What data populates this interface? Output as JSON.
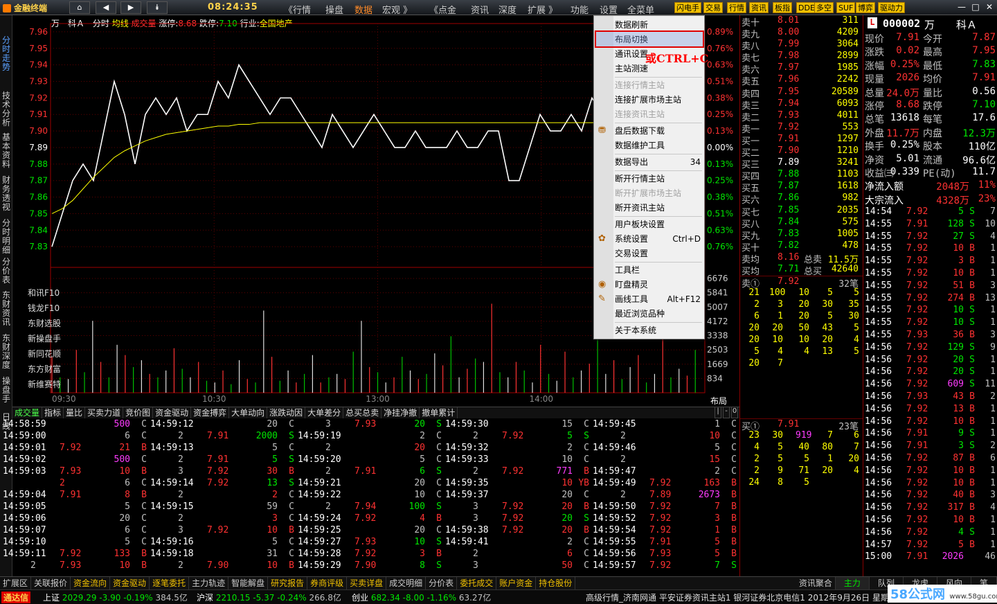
{
  "titlebar": {
    "app_name": "金融终端",
    "clock": "08:24:35",
    "menus": [
      "《行情",
      "操盘",
      "数据",
      "宏观 》",
      "《点金",
      "资讯",
      "深度",
      "扩展 》",
      "功能",
      "设置",
      "全菜单"
    ],
    "active_menu": "数据",
    "buttons": [
      "闪电手",
      "交易",
      "行情",
      "资讯",
      "板指",
      "DDE",
      "多空",
      "SUF",
      "博弈",
      "驱动力"
    ]
  },
  "sidebar": {
    "tabs": [
      "分时走势",
      "技术分析",
      "基本资料",
      "财务透视",
      "分时明细",
      "分价表",
      "东财资讯",
      "东财深度",
      "操盘手",
      "日线"
    ]
  },
  "chart_header": {
    "code": "万　科Ａ",
    "items": [
      "分时",
      "均线",
      "成交量"
    ],
    "limit_up_label": "涨停:",
    "limit_up": "8.68",
    "limit_down_label": "跌停:",
    "limit_down": "7.10",
    "industry_label": "行业:",
    "industry": "全国地产"
  },
  "chart_data": {
    "type": "line",
    "price_ticks": [
      "7.96",
      "7.95",
      "7.94",
      "7.93",
      "7.92",
      "7.91",
      "7.90",
      "7.89",
      "7.88",
      "7.87",
      "7.86",
      "7.85",
      "7.84",
      "7.83"
    ],
    "pct_ticks": [
      "0.89%",
      "0.76%",
      "0.63%",
      "0.51%",
      "0.38%",
      "0.25%",
      "0.13%",
      "0.00%",
      "0.13%",
      "0.25%",
      "0.38%",
      "0.51%",
      "0.63%",
      "0.76%"
    ],
    "vol_ticks": [
      "6676",
      "5841",
      "5007",
      "4172",
      "3338",
      "2503",
      "1669",
      "834"
    ],
    "time_ticks": [
      "09:30",
      "10:30",
      "13:00",
      "14:00"
    ],
    "ylim": [
      7.82,
      7.965
    ],
    "prev_close": 7.89,
    "price_series": [
      7.83,
      7.85,
      7.87,
      7.88,
      7.87,
      7.9,
      7.93,
      7.91,
      7.88,
      7.91,
      7.92,
      7.91,
      7.92,
      7.9,
      7.91,
      7.91,
      7.93,
      7.92,
      7.94,
      7.93,
      7.92,
      7.91,
      7.92,
      7.92,
      7.91,
      7.9,
      7.89,
      7.91,
      7.9,
      7.89,
      7.9,
      7.91,
      7.9,
      7.89,
      7.89,
      7.9,
      7.89,
      7.89,
      7.89,
      7.9,
      7.89,
      7.89,
      7.9,
      7.9,
      7.87,
      7.87,
      7.89,
      7.91,
      7.9,
      7.9,
      7.91,
      7.9,
      7.92,
      7.91
    ],
    "avg_series": [
      7.85,
      7.853,
      7.858,
      7.865,
      7.872,
      7.878,
      7.884,
      7.888,
      7.891,
      7.894,
      7.896,
      7.898,
      7.899,
      7.9,
      7.901,
      7.902,
      7.903,
      7.903,
      7.904,
      7.904,
      7.905,
      7.905,
      7.905,
      7.905,
      7.905,
      7.905,
      7.905,
      7.905,
      7.905,
      7.905,
      7.905,
      7.905,
      7.905,
      7.905,
      7.905,
      7.905,
      7.905,
      7.905,
      7.905,
      7.905,
      7.905,
      7.905,
      7.905,
      7.905,
      7.905,
      7.905,
      7.905,
      7.905,
      7.905,
      7.905,
      7.905,
      7.905,
      7.905,
      7.905
    ],
    "vol_ylim": [
      0,
      7000
    ],
    "volume_series": [
      2100,
      900,
      800,
      2500,
      1200,
      4200,
      1800,
      900,
      2800,
      2200,
      1500,
      1900,
      1100,
      900,
      1300,
      2600,
      1400,
      900,
      1800,
      700,
      600,
      1300,
      500,
      1900,
      800,
      600,
      4800,
      2100,
      700,
      1300,
      600,
      1100,
      2200,
      600,
      900,
      1100,
      800,
      2400,
      4200,
      1500,
      1200,
      600,
      900,
      2100,
      1300,
      800,
      1100,
      2300,
      1600,
      3300,
      900,
      1400,
      2000,
      1800,
      5200,
      1200,
      900,
      1800,
      1300,
      600,
      2800,
      1100,
      700,
      2400,
      900,
      1300,
      1700,
      3100,
      1100,
      1900,
      800,
      1500,
      2200,
      600,
      1100,
      3600,
      900,
      1400,
      1000,
      2500
    ]
  },
  "chart_links": [
    "和讯F10",
    "钱龙F10",
    "东财选股",
    "新操盘手",
    "新同花顺",
    "东方财富",
    "新维赛特"
  ],
  "layout_label": "布局",
  "mid_tabs": [
    "成交量",
    "指标",
    "量比",
    "买卖力道",
    "竞价图",
    "资金驱动",
    "资金搏弈",
    "大单动向",
    "涨跌动因",
    "大单差分",
    "总买总卖",
    "净挂净撤",
    "撤单累计"
  ],
  "mid_tab_right": [
    "|",
    "-",
    "0"
  ],
  "context_menu": {
    "items": [
      {
        "label": "数据刷新",
        "enabled": true
      },
      {
        "label": "布局切换",
        "enabled": true,
        "highlight": true
      },
      {
        "label": "通讯设置",
        "enabled": true
      },
      {
        "label": "主站测速",
        "enabled": true
      },
      {
        "sep": true
      },
      {
        "label": "连接行情主站",
        "enabled": false
      },
      {
        "label": "连接扩展市场主站",
        "enabled": true
      },
      {
        "label": "连接资讯主站",
        "enabled": false
      },
      {
        "sep": true
      },
      {
        "label": "盘后数据下载",
        "enabled": true,
        "icon": "download-icon"
      },
      {
        "label": "数据维护工具",
        "enabled": true
      },
      {
        "sep": true
      },
      {
        "label": "数据导出",
        "enabled": true,
        "shortcut": "34"
      },
      {
        "sep": true
      },
      {
        "label": "断开行情主站",
        "enabled": true
      },
      {
        "label": "断开扩展市场主站",
        "enabled": false
      },
      {
        "label": "断开资讯主站",
        "enabled": true
      },
      {
        "sep": true
      },
      {
        "label": "用户板块设置",
        "enabled": true
      },
      {
        "label": "系统设置",
        "enabled": true,
        "shortcut": "Ctrl+D",
        "icon": "gear-icon"
      },
      {
        "label": "交易设置",
        "enabled": true
      },
      {
        "sep": true
      },
      {
        "label": "工具栏",
        "enabled": true
      },
      {
        "label": "盯盘精灵",
        "enabled": true,
        "icon": "eye-icon"
      },
      {
        "label": "画线工具",
        "enabled": true,
        "shortcut": "Alt+F12",
        "icon": "pencil-icon"
      },
      {
        "label": "最近浏览品种",
        "enabled": true
      },
      {
        "sep": true
      },
      {
        "label": "关于本系统",
        "enabled": true
      }
    ],
    "annotation": "或CTRL+C"
  },
  "order_book": {
    "asks": [
      [
        "卖十",
        "8.01",
        "311"
      ],
      [
        "卖九",
        "8.00",
        "4209"
      ],
      [
        "卖八",
        "7.99",
        "3064"
      ],
      [
        "卖七",
        "7.98",
        "2899"
      ],
      [
        "卖六",
        "7.97",
        "1985"
      ],
      [
        "卖五",
        "7.96",
        "2242"
      ],
      [
        "卖四",
        "7.95",
        "20589"
      ],
      [
        "卖三",
        "7.94",
        "6093"
      ],
      [
        "卖二",
        "7.93",
        "4011"
      ],
      [
        "卖一",
        "7.92",
        "553"
      ]
    ],
    "bids": [
      [
        "买一",
        "7.91",
        "1297"
      ],
      [
        "买二",
        "7.90",
        "1210"
      ],
      [
        "买三",
        "7.89",
        "3241"
      ],
      [
        "买四",
        "7.88",
        "1103"
      ],
      [
        "买五",
        "7.87",
        "1618"
      ],
      [
        "买六",
        "7.86",
        "982"
      ],
      [
        "买七",
        "7.85",
        "2035"
      ],
      [
        "买八",
        "7.84",
        "575"
      ],
      [
        "买九",
        "7.83",
        "1005"
      ],
      [
        "买十",
        "7.82",
        "478"
      ]
    ],
    "avg_sell_label": "卖均",
    "avg_sell": "8.16",
    "total_sell_label": "总卖",
    "total_sell": "11.5万",
    "avg_buy_label": "买均",
    "avg_buy": "7.71",
    "total_buy_label": "总买",
    "total_buy": "42640",
    "sell1_queue_label": "卖①",
    "sell1_price": "7.92",
    "sell1_count": "32笔",
    "sell1_queue": [
      [
        "21",
        "100",
        "10",
        "5",
        "5"
      ],
      [
        "2",
        "3",
        "20",
        "30",
        "35"
      ],
      [
        "6",
        "1",
        "20",
        "5",
        "30"
      ],
      [
        "20",
        "20",
        "50",
        "43",
        "5"
      ],
      [
        "20",
        "10",
        "10",
        "20",
        "4"
      ],
      [
        "5",
        "4",
        "4",
        "13",
        "5"
      ],
      [
        "20",
        "7",
        "",
        "",
        ""
      ]
    ],
    "buy1_queue_label": "买①",
    "buy1_price": "7.91",
    "buy1_count": "23笔",
    "buy1_queue": [
      [
        "23",
        "30",
        "919",
        "7",
        "6"
      ],
      [
        "4",
        "5",
        "40",
        "80",
        "7"
      ],
      [
        "2",
        "5",
        "5",
        "1",
        "20"
      ],
      [
        "2",
        "9",
        "71",
        "20",
        "4"
      ],
      [
        "24",
        "8",
        "5",
        "",
        ""
      ]
    ]
  },
  "quote": {
    "code": "000002",
    "unit": "万",
    "name": "科Ａ",
    "rows": [
      [
        "现价",
        "7.91",
        "今开",
        "7.87"
      ],
      [
        "涨跌",
        "0.02",
        "最高",
        "7.95"
      ],
      [
        "涨幅",
        "0.25%",
        "最低",
        "7.83"
      ],
      [
        "现量",
        "2026",
        "均价",
        "7.91"
      ],
      [
        "总量",
        "24.0万",
        "量比",
        "0.56"
      ],
      [
        "涨停",
        "8.68",
        "跌停",
        "7.10"
      ],
      [
        "总笔",
        "13618",
        "每笔",
        "17.6"
      ],
      [
        "外盘",
        "11.7万",
        "内盘",
        "12.3万"
      ],
      [
        "换手",
        "0.25%",
        "股本",
        "110亿"
      ],
      [
        "净资",
        "5.01",
        "流通",
        "96.6亿"
      ],
      [
        "收益㈢",
        "0.339",
        "PE(动)",
        "11.7"
      ]
    ],
    "flow": [
      [
        "净流入额",
        "2048万",
        "11%"
      ],
      [
        "大宗流入",
        "4328万",
        "23%"
      ]
    ],
    "ticks": [
      [
        "14:54",
        "7.92",
        "5",
        "S",
        "7"
      ],
      [
        "14:55",
        "7.91",
        "128",
        "S",
        "10"
      ],
      [
        "14:55",
        "7.92",
        "27",
        "S",
        "4"
      ],
      [
        "14:55",
        "7.92",
        "10",
        "B",
        "1"
      ],
      [
        "14:55",
        "7.92",
        "3",
        "B",
        "1"
      ],
      [
        "14:55",
        "7.92",
        "10",
        "B",
        "1"
      ],
      [
        "14:55",
        "7.92",
        "51",
        "B",
        "3"
      ],
      [
        "14:55",
        "7.92",
        "274",
        "B",
        "13"
      ],
      [
        "14:55",
        "7.92",
        "10",
        "S",
        "1"
      ],
      [
        "14:55",
        "7.92",
        "10",
        "S",
        "1"
      ],
      [
        "14:55",
        "7.93",
        "36",
        "B",
        "3"
      ],
      [
        "14:56",
        "7.92",
        "129",
        "S",
        "9"
      ],
      [
        "14:56",
        "7.92",
        "20",
        "S",
        "1"
      ],
      [
        "14:56",
        "7.92",
        "20",
        "S",
        "1"
      ],
      [
        "14:56",
        "7.92",
        "609",
        "S",
        "11"
      ],
      [
        "14:56",
        "7.93",
        "43",
        "B",
        "2"
      ],
      [
        "14:56",
        "7.92",
        "13",
        "B",
        "1"
      ],
      [
        "14:56",
        "7.92",
        "10",
        "B",
        "1"
      ],
      [
        "14:56",
        "7.91",
        "9",
        "S",
        "1"
      ],
      [
        "14:56",
        "7.91",
        "3",
        "S",
        "2"
      ],
      [
        "14:56",
        "7.92",
        "87",
        "B",
        "6"
      ],
      [
        "14:56",
        "7.92",
        "10",
        "B",
        "1"
      ],
      [
        "14:56",
        "7.92",
        "10",
        "B",
        "1"
      ],
      [
        "14:56",
        "7.92",
        "40",
        "B",
        "3"
      ],
      [
        "14:56",
        "7.92",
        "317",
        "B",
        "4"
      ],
      [
        "14:56",
        "7.92",
        "10",
        "B",
        "1"
      ],
      [
        "14:56",
        "7.92",
        "4",
        "S",
        "1"
      ],
      [
        "14:57",
        "7.92",
        "5",
        "B",
        "1"
      ],
      [
        "15:00",
        "7.91",
        "2026",
        "",
        "46"
      ]
    ]
  },
  "trades": {
    "columns": [
      [
        [
          "14:58:59",
          "",
          "500",
          "C"
        ],
        [
          "14:59:00",
          "",
          "6",
          "C"
        ],
        [
          "14:59:01",
          "7.92",
          "21",
          "B"
        ],
        [
          "14:59:02",
          "",
          "500",
          "C"
        ],
        [
          "14:59:03",
          "7.93",
          "10",
          "B"
        ],
        [
          "",
          "2",
          "6",
          "C"
        ],
        [
          "14:59:04",
          "7.91",
          "8",
          "B"
        ],
        [
          "14:59:05",
          "",
          "5",
          "C"
        ],
        [
          "14:59:06",
          "",
          "20",
          "C"
        ],
        [
          "14:59:07",
          "",
          "6",
          "C"
        ],
        [
          "14:59:10",
          "",
          "5",
          "C"
        ],
        [
          "14:59:11",
          "7.92",
          "133",
          "B"
        ],
        [
          "",
          "2",
          "7.93",
          "10",
          "B"
        ]
      ],
      [
        [
          "14:59:12",
          "",
          "20",
          "C"
        ],
        [
          "",
          "2",
          "7.91",
          "2000",
          "S"
        ],
        [
          "14:59:13",
          "",
          "5",
          "C"
        ],
        [
          "",
          "2",
          "7.91",
          "5",
          "S"
        ],
        [
          "",
          "3",
          "7.92",
          "30",
          "B"
        ],
        [
          "14:59:14",
          "7.92",
          "13",
          "S"
        ],
        [
          "",
          "2",
          "",
          "2",
          "C"
        ],
        [
          "14:59:15",
          "",
          "59",
          "C"
        ],
        [
          "",
          "2",
          "",
          "3",
          "C"
        ],
        [
          "",
          "3",
          "7.92",
          "10",
          "B"
        ],
        [
          "14:59:16",
          "",
          "5",
          "C"
        ],
        [
          "14:59:18",
          "",
          "31",
          "C"
        ],
        [
          "",
          "2",
          "7.90",
          "10",
          "B"
        ]
      ],
      [
        [
          "",
          "3",
          "7.93",
          "20",
          "S"
        ],
        [
          "14:59:19",
          "",
          "2",
          "C"
        ],
        [
          "",
          "2",
          "",
          "20",
          "C"
        ],
        [
          "14:59:20",
          "",
          "5",
          "C"
        ],
        [
          "",
          "2",
          "7.91",
          "6",
          "S"
        ],
        [
          "14:59:21",
          "",
          "20",
          "C"
        ],
        [
          "14:59:22",
          "",
          "10",
          "C"
        ],
        [
          "",
          "2",
          "7.94",
          "100",
          "S"
        ],
        [
          "14:59:24",
          "7.92",
          "4",
          "B"
        ],
        [
          "14:59:25",
          "",
          "20",
          "C"
        ],
        [
          "14:59:27",
          "7.93",
          "10",
          "S"
        ],
        [
          "14:59:28",
          "7.92",
          "3",
          "B"
        ],
        [
          "14:59:29",
          "7.90",
          "8",
          "S"
        ]
      ],
      [
        [
          "14:59:30",
          "",
          "15",
          "C"
        ],
        [
          "",
          "2",
          "7.92",
          "5",
          "S"
        ],
        [
          "14:59:32",
          "",
          "2",
          "C"
        ],
        [
          "14:59:33",
          "",
          "10",
          "C"
        ],
        [
          "",
          "2",
          "7.92",
          "771",
          "B"
        ],
        [
          "14:59:35",
          "",
          "10",
          "YB"
        ],
        [
          "14:59:37",
          "",
          "20",
          "C"
        ],
        [
          "",
          "3",
          "7.92",
          "20",
          "B"
        ],
        [
          "",
          "3",
          "7.92",
          "20",
          "S"
        ],
        [
          "14:59:38",
          "7.92",
          "20",
          "B"
        ],
        [
          "14:59:41",
          "",
          "2",
          "C"
        ],
        [
          "",
          "2",
          "",
          "6",
          "C"
        ],
        [
          "",
          "3",
          "",
          "50",
          "C"
        ]
      ],
      [
        [
          "14:59:45",
          "",
          "1",
          "C"
        ],
        [
          "",
          "2",
          "",
          "10",
          "C"
        ],
        [
          "14:59:46",
          "",
          "5",
          "C"
        ],
        [
          "",
          "2",
          "",
          "15",
          "C"
        ],
        [
          "14:59:47",
          "",
          "2",
          "C"
        ],
        [
          "14:59:49",
          "7.92",
          "163",
          "B"
        ],
        [
          "",
          "2",
          "7.89",
          "2673",
          "B"
        ],
        [
          "14:59:50",
          "7.92",
          "7",
          "B"
        ],
        [
          "14:59:52",
          "7.92",
          "3",
          "B"
        ],
        [
          "14:59:54",
          "7.92",
          "1",
          "B"
        ],
        [
          "14:59:55",
          "7.91",
          "5",
          "B"
        ],
        [
          "14:59:56",
          "7.93",
          "5",
          "B"
        ],
        [
          "14:59:57",
          "7.92",
          "7",
          "S"
        ]
      ]
    ]
  },
  "bottom_tabs": [
    "扩展区",
    "关联报价",
    "资金流向",
    "资金驱动",
    "逐笔委托",
    "主力轨迹",
    "智能解盘",
    "研究报告",
    "券商评级",
    "买卖详盘",
    "成交明细",
    "分价表",
    "委托成交",
    "账户资金",
    "持仓股份"
  ],
  "bottom_right_tabs": [
    "资讯聚合",
    "主力",
    "队列",
    "龙虎",
    "风向",
    "笔"
  ],
  "status": {
    "badge": "通达信",
    "index1_name": "上证",
    "index1": "2029.29",
    "index1_chg": "-3.90",
    "index1_pct": "-0.19%",
    "index1_amt": "384.5亿",
    "index2_name": "沪深",
    "index2": "2210.15",
    "index2_chg": "-5.37",
    "index2_pct": "-0.24%",
    "index2_amt": "266.8亿",
    "index3_name": "创业",
    "index3": "682.34",
    "index3_chg": "-8.00",
    "index3_pct": "-1.16%",
    "index3_amt": "63.27亿",
    "info": "高级行情_济南网通  平安证券资讯主站1  银河证券北京电信1  2012年9月26日  星期",
    "watermark": "58公式网",
    "watermark_url": "www.58gu.com"
  }
}
